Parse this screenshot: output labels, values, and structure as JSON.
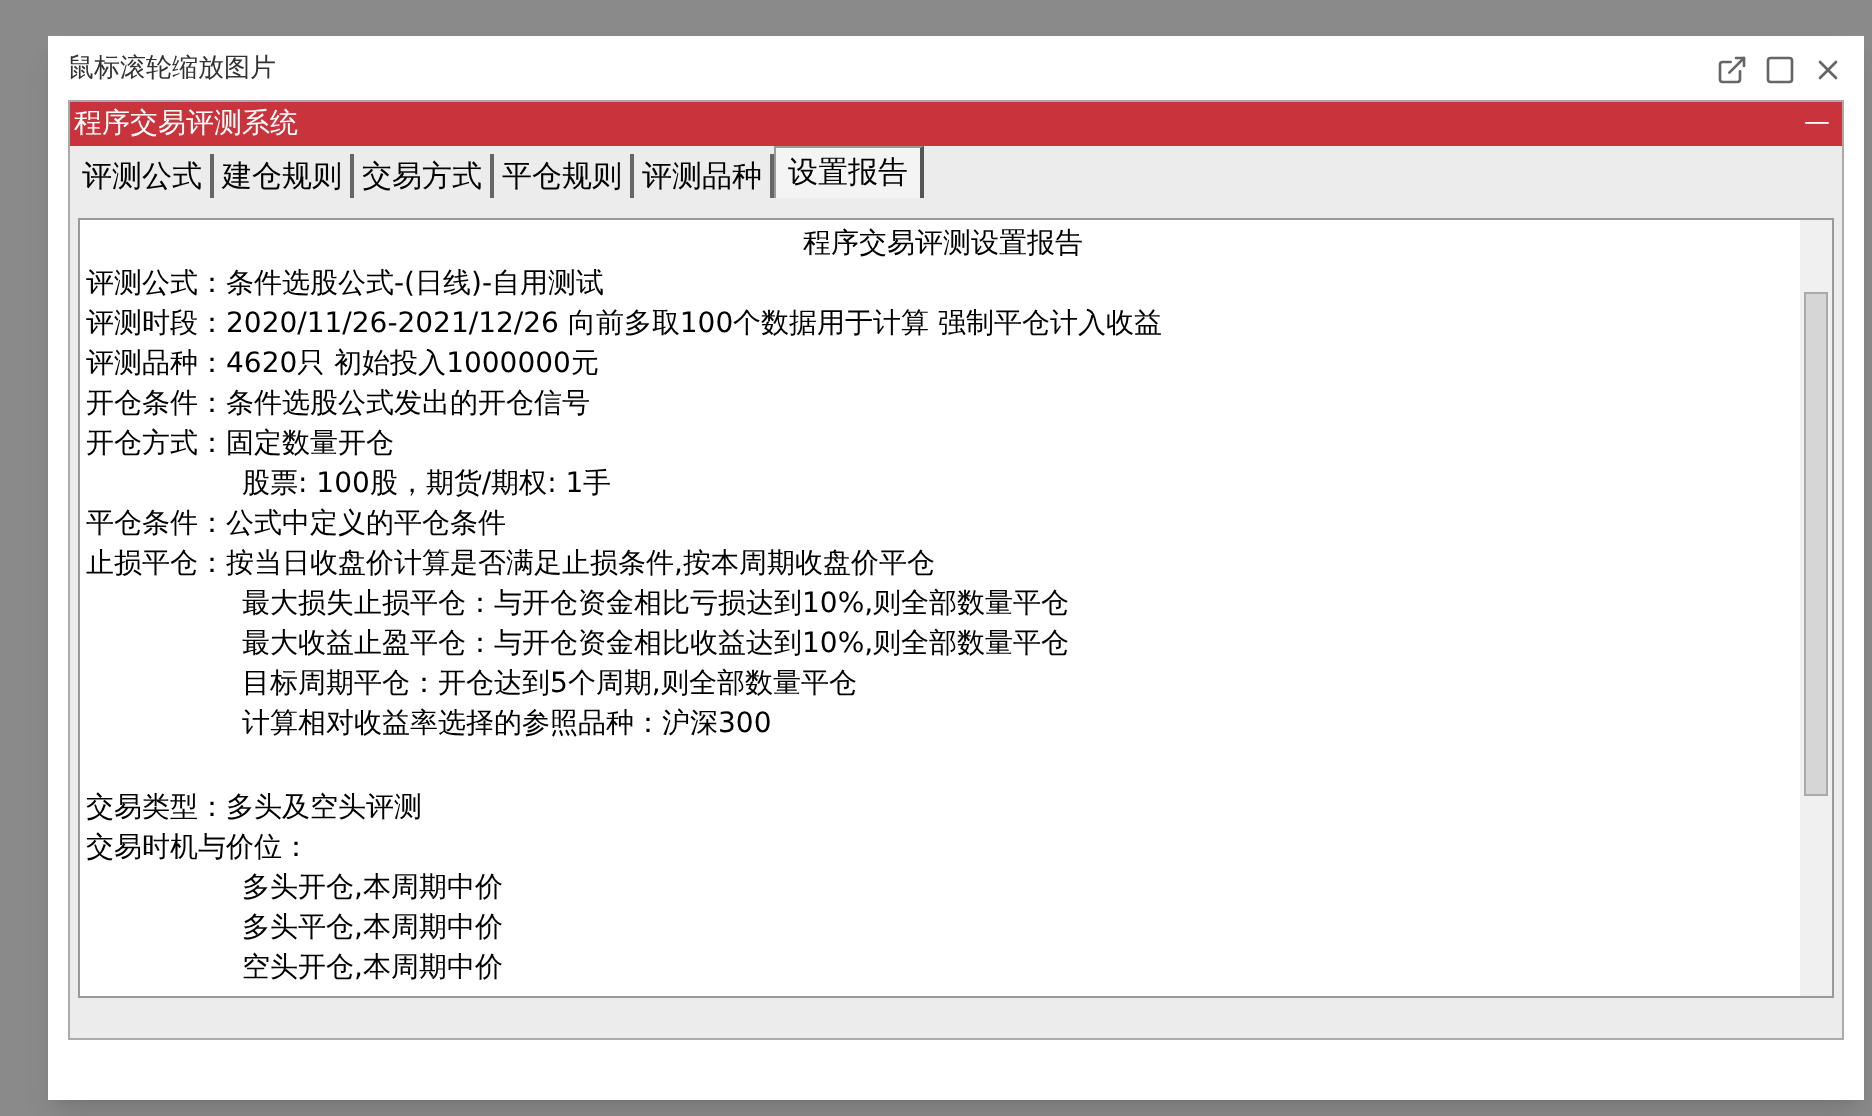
{
  "viewer": {
    "title": "鼠标滚轮缩放图片"
  },
  "app": {
    "title": "程序交易评测系统",
    "minimize": "—"
  },
  "tabs": [
    {
      "label": "评测公式",
      "selected": false
    },
    {
      "label": "建仓规则",
      "selected": false
    },
    {
      "label": "交易方式",
      "selected": false
    },
    {
      "label": "平仓规则",
      "selected": false
    },
    {
      "label": "评测品种",
      "selected": false
    },
    {
      "label": "设置报告",
      "selected": true
    }
  ],
  "report": [
    {
      "kind": "title",
      "text": "程序交易评测设置报告"
    },
    {
      "kind": "field",
      "label": "评测公式：",
      "value": "条件选股公式-(日线)-自用测试"
    },
    {
      "kind": "field",
      "label": "评测时段：",
      "value": "2020/11/26-2021/12/26 向前多取100个数据用于计算 强制平仓计入收益"
    },
    {
      "kind": "field",
      "label": "评测品种：",
      "value": "4620只 初始投入1000000元"
    },
    {
      "kind": "field",
      "label": "开仓条件：",
      "value": "条件选股公式发出的开仓信号"
    },
    {
      "kind": "field",
      "label": "开仓方式：",
      "value": "固定数量开仓"
    },
    {
      "kind": "indent",
      "text": "股票: 100股，期货/期权: 1手"
    },
    {
      "kind": "field",
      "label": "平仓条件：",
      "value": "公式中定义的平仓条件"
    },
    {
      "kind": "field",
      "label": "止损平仓：",
      "value": "按当日收盘价计算是否满足止损条件,按本周期收盘价平仓"
    },
    {
      "kind": "indent",
      "text": "最大损失止损平仓：与开仓资金相比亏损达到10%,则全部数量平仓"
    },
    {
      "kind": "indent",
      "text": "最大收益止盈平仓：与开仓资金相比收益达到10%,则全部数量平仓"
    },
    {
      "kind": "indent",
      "text": "目标周期平仓：开仓达到5个周期,则全部数量平仓"
    },
    {
      "kind": "indent",
      "text": "计算相对收益率选择的参照品种：沪深300"
    },
    {
      "kind": "gap"
    },
    {
      "kind": "field",
      "label": "交易类型：",
      "value": "多头及空头评测"
    },
    {
      "kind": "field",
      "label": "交易时机与价位："
    },
    {
      "kind": "indent",
      "text": "多头开仓,本周期中价"
    },
    {
      "kind": "indent",
      "text": "多头平仓,本周期中价"
    },
    {
      "kind": "indent",
      "text": "空头开仓,本周期中价"
    }
  ]
}
